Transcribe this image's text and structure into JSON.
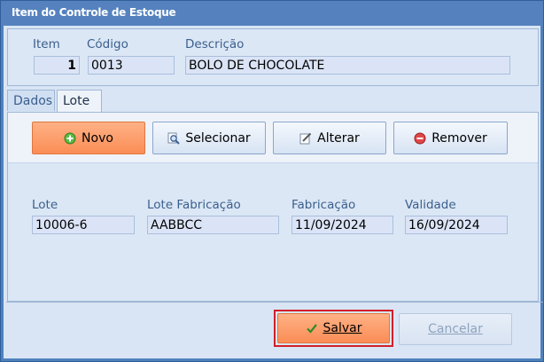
{
  "window": {
    "title": "Item do Controle de Estoque"
  },
  "header": {
    "item_label": "Item",
    "item_value": "1",
    "codigo_label": "Código",
    "codigo_value": "0013",
    "descricao_label": "Descrição",
    "descricao_value": "BOLO DE CHOCOLATE"
  },
  "tabs": [
    {
      "label": "Dados",
      "active": false
    },
    {
      "label": "Lote",
      "active": true
    }
  ],
  "toolbar": {
    "novo_label": "Novo",
    "selecionar_label": "Selecionar",
    "alterar_label": "Alterar",
    "remover_label": "Remover"
  },
  "lote": {
    "lote_label": "Lote",
    "lote_value": "10006-6",
    "lote_fabricacao_label": "Lote Fabricação",
    "lote_fabricacao_value": "AABBCC",
    "fabricacao_label": "Fabricação",
    "fabricacao_value": "11/09/2024",
    "validade_label": "Validade",
    "validade_value": "16/09/2024"
  },
  "footer": {
    "salvar_label": "Salvar",
    "cancelar_label": "Cancelar"
  },
  "colors": {
    "title_bar": "#5582be",
    "accent_orange": "#fa8d56",
    "focus_red": "#d21f2a"
  }
}
